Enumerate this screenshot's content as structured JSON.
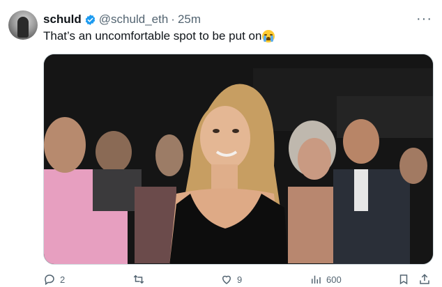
{
  "tweet": {
    "author_name": "schuld",
    "handle": "@schuld_eth",
    "separator": "·",
    "time": "25m",
    "text": "That’s an uncomfortable spot to be put on",
    "emoji": "loudly-crying-face"
  },
  "actions": {
    "reply_count": "2",
    "like_count": "9",
    "view_count": "600"
  },
  "colors": {
    "verified_badge": "#1d9bf0",
    "secondary_text": "#536471",
    "primary_text": "#0f1419"
  },
  "icons": [
    "verified-icon",
    "more-icon",
    "reply-icon",
    "retweet-icon",
    "like-icon",
    "views-icon",
    "bookmark-icon",
    "share-icon"
  ]
}
